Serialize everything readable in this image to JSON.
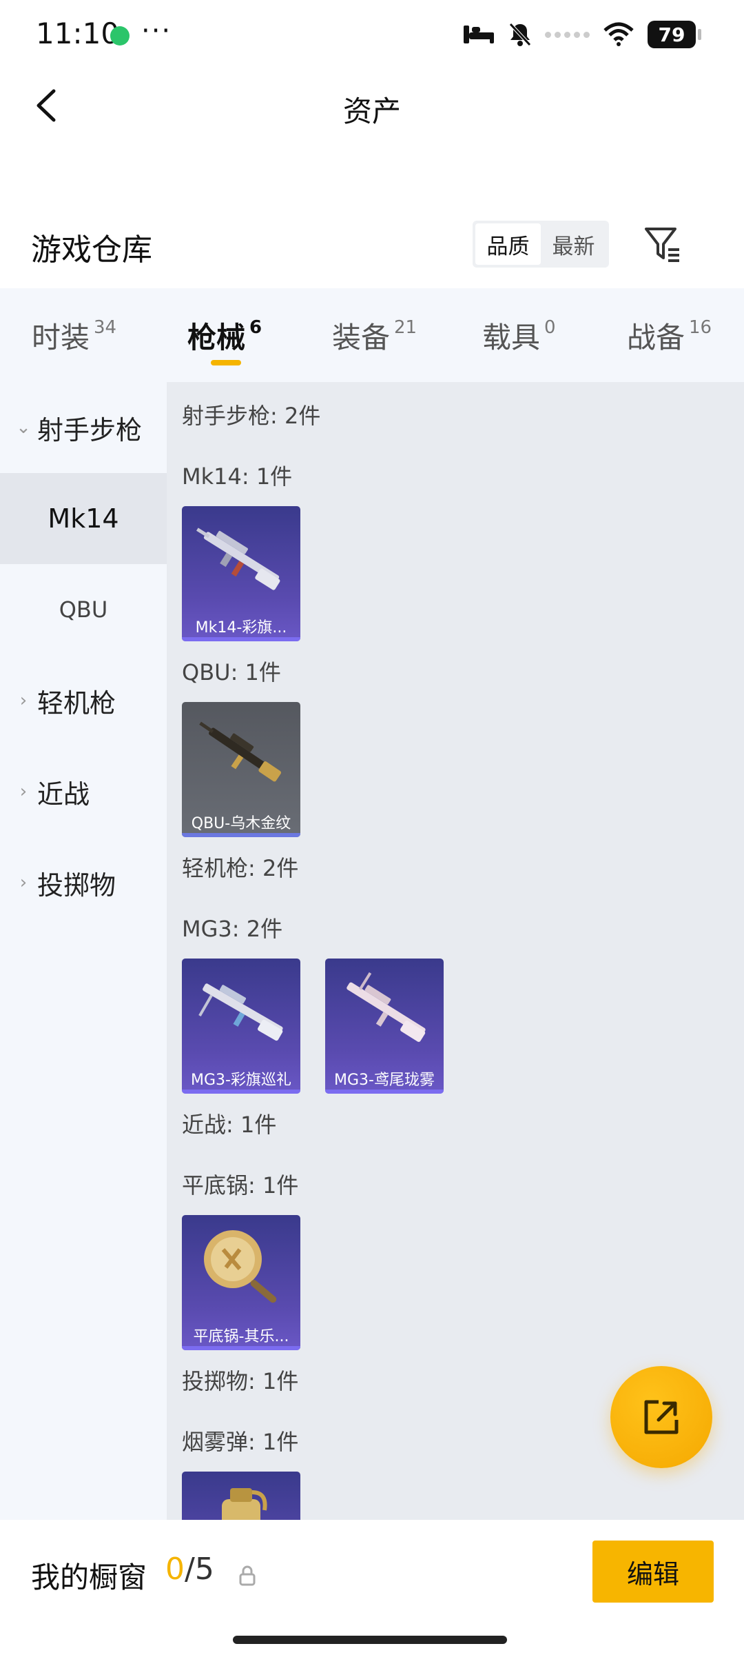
{
  "status_bar": {
    "time": "11:10",
    "dots": "···",
    "battery": "79"
  },
  "header": {
    "title": "资产"
  },
  "warehouse": {
    "title": "游戏仓库",
    "sort_options": [
      {
        "label": "品质",
        "active": true
      },
      {
        "label": "最新",
        "active": false
      }
    ]
  },
  "tabs": [
    {
      "label": "时装",
      "count": "34"
    },
    {
      "label": "枪械",
      "count": "6"
    },
    {
      "label": "装备",
      "count": "21"
    },
    {
      "label": "载具",
      "count": "0"
    },
    {
      "label": "战备",
      "count": "16"
    }
  ],
  "sidebar": {
    "groups": [
      {
        "label": "射手步枪",
        "chevron": "⌄"
      },
      {
        "label": "轻机枪",
        "chevron": "›"
      },
      {
        "label": "近战",
        "chevron": "›"
      },
      {
        "label": "投掷物",
        "chevron": "›"
      }
    ],
    "subs": [
      "Mk14",
      "QBU"
    ]
  },
  "content": {
    "labels": [
      "射手步枪: 2件",
      "Mk14: 1件",
      "QBU: 1件",
      "轻机枪: 2件",
      "MG3: 2件",
      "近战: 1件",
      "平底锅: 1件",
      "投掷物: 1件",
      "烟雾弹: 1件"
    ],
    "items": [
      "Mk14-彩旗...",
      "QBU-乌木金纹",
      "MG3-彩旗巡礼",
      "MG3-鸢尾珑雾",
      "平底锅-其乐...",
      ""
    ]
  },
  "bottom": {
    "showcase_label": "我的橱窗",
    "showcase_current": "0",
    "showcase_total": "/5",
    "edit_label": "编辑"
  }
}
